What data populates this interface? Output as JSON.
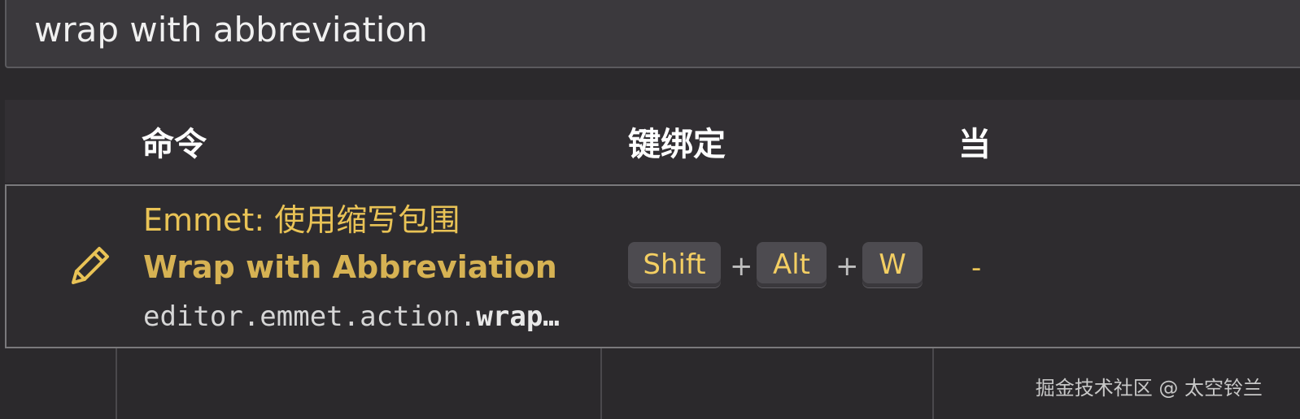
{
  "search": {
    "value": "wrap with abbreviation"
  },
  "table": {
    "headers": {
      "command": "命令",
      "keybinding": "键绑定",
      "when": "当"
    },
    "row": {
      "title": "Emmet: 使用缩写包围",
      "title_en": "Wrap with Abbreviation",
      "command_id_prefix": "editor.emmet.action.",
      "command_id_bold": "wrap…",
      "keys": [
        "Shift",
        "Alt",
        "W"
      ],
      "plus": "+",
      "when": "-"
    }
  },
  "watermark": "掘金技术社区 @ 太空铃兰",
  "colors": {
    "accent": "#e9c356",
    "background": "#2b292c",
    "header_bg": "#322f33"
  },
  "icons": {
    "edit": "pencil-icon"
  }
}
